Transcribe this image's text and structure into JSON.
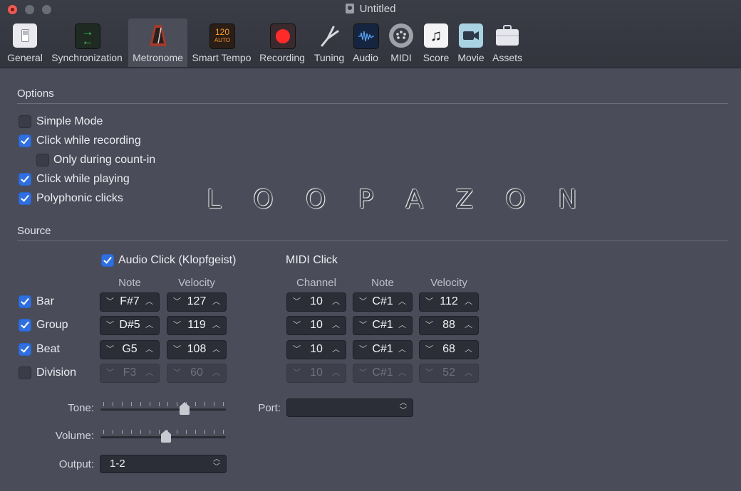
{
  "window": {
    "title": "Untitled"
  },
  "colors": {
    "accent": "#2f6fe0",
    "background": "#4a4c5a",
    "close": "#ee5a52"
  },
  "toolbar": {
    "tabs": [
      {
        "label": "General",
        "icon": "general-switch-icon"
      },
      {
        "label": "Synchronization",
        "icon": "sync-arrows-icon"
      },
      {
        "label": "Metronome",
        "icon": "metronome-icon",
        "active": true
      },
      {
        "label": "Smart Tempo",
        "icon": "smart-tempo-icon",
        "badge_top": "120",
        "badge_bottom": "AUTO"
      },
      {
        "label": "Recording",
        "icon": "record-icon"
      },
      {
        "label": "Tuning",
        "icon": "tuning-fork-icon"
      },
      {
        "label": "Audio",
        "icon": "audio-waveform-icon"
      },
      {
        "label": "MIDI",
        "icon": "midi-port-icon"
      },
      {
        "label": "Score",
        "icon": "music-note-icon"
      },
      {
        "label": "Movie",
        "icon": "movie-camera-icon"
      },
      {
        "label": "Assets",
        "icon": "briefcase-icon"
      }
    ]
  },
  "options": {
    "header": "Options",
    "simple_mode": {
      "label": "Simple Mode",
      "checked": false
    },
    "click_while_recording": {
      "label": "Click while recording",
      "checked": true
    },
    "only_during_count_in": {
      "label": "Only during count-in",
      "checked": false
    },
    "click_while_playing": {
      "label": "Click while playing",
      "checked": true
    },
    "polyphonic_clicks": {
      "label": "Polyphonic clicks",
      "checked": true
    }
  },
  "watermark": {
    "letters": [
      "L",
      "O",
      "O",
      "P",
      "A",
      "Z",
      "O",
      "N"
    ]
  },
  "source": {
    "header": "Source",
    "audio_click": {
      "label": "Audio Click (Klopfgeist)",
      "checked": true
    },
    "midi_click": {
      "label": "MIDI Click"
    },
    "audio_columns": {
      "note": "Note",
      "velocity": "Velocity"
    },
    "midi_columns": {
      "channel": "Channel",
      "note": "Note",
      "velocity": "Velocity"
    },
    "rows": [
      {
        "label": "Bar",
        "checked": true,
        "note": "F#7",
        "velocity": "127",
        "midi_channel": "10",
        "midi_note": "C#1",
        "midi_velocity": "112"
      },
      {
        "label": "Group",
        "checked": true,
        "note": "D#5",
        "velocity": "119",
        "midi_channel": "10",
        "midi_note": "C#1",
        "midi_velocity": "88"
      },
      {
        "label": "Beat",
        "checked": true,
        "note": "G5",
        "velocity": "108",
        "midi_channel": "10",
        "midi_note": "C#1",
        "midi_velocity": "68"
      },
      {
        "label": "Division",
        "checked": false,
        "note": "F3",
        "velocity": "60",
        "midi_channel": "10",
        "midi_note": "C#1",
        "midi_velocity": "52"
      }
    ],
    "tone": {
      "label": "Tone:",
      "level": 0.67
    },
    "volume": {
      "label": "Volume:",
      "level": 0.52
    },
    "output": {
      "label": "Output:",
      "value": "1-2"
    },
    "port": {
      "label": "Port:",
      "value": ""
    }
  }
}
